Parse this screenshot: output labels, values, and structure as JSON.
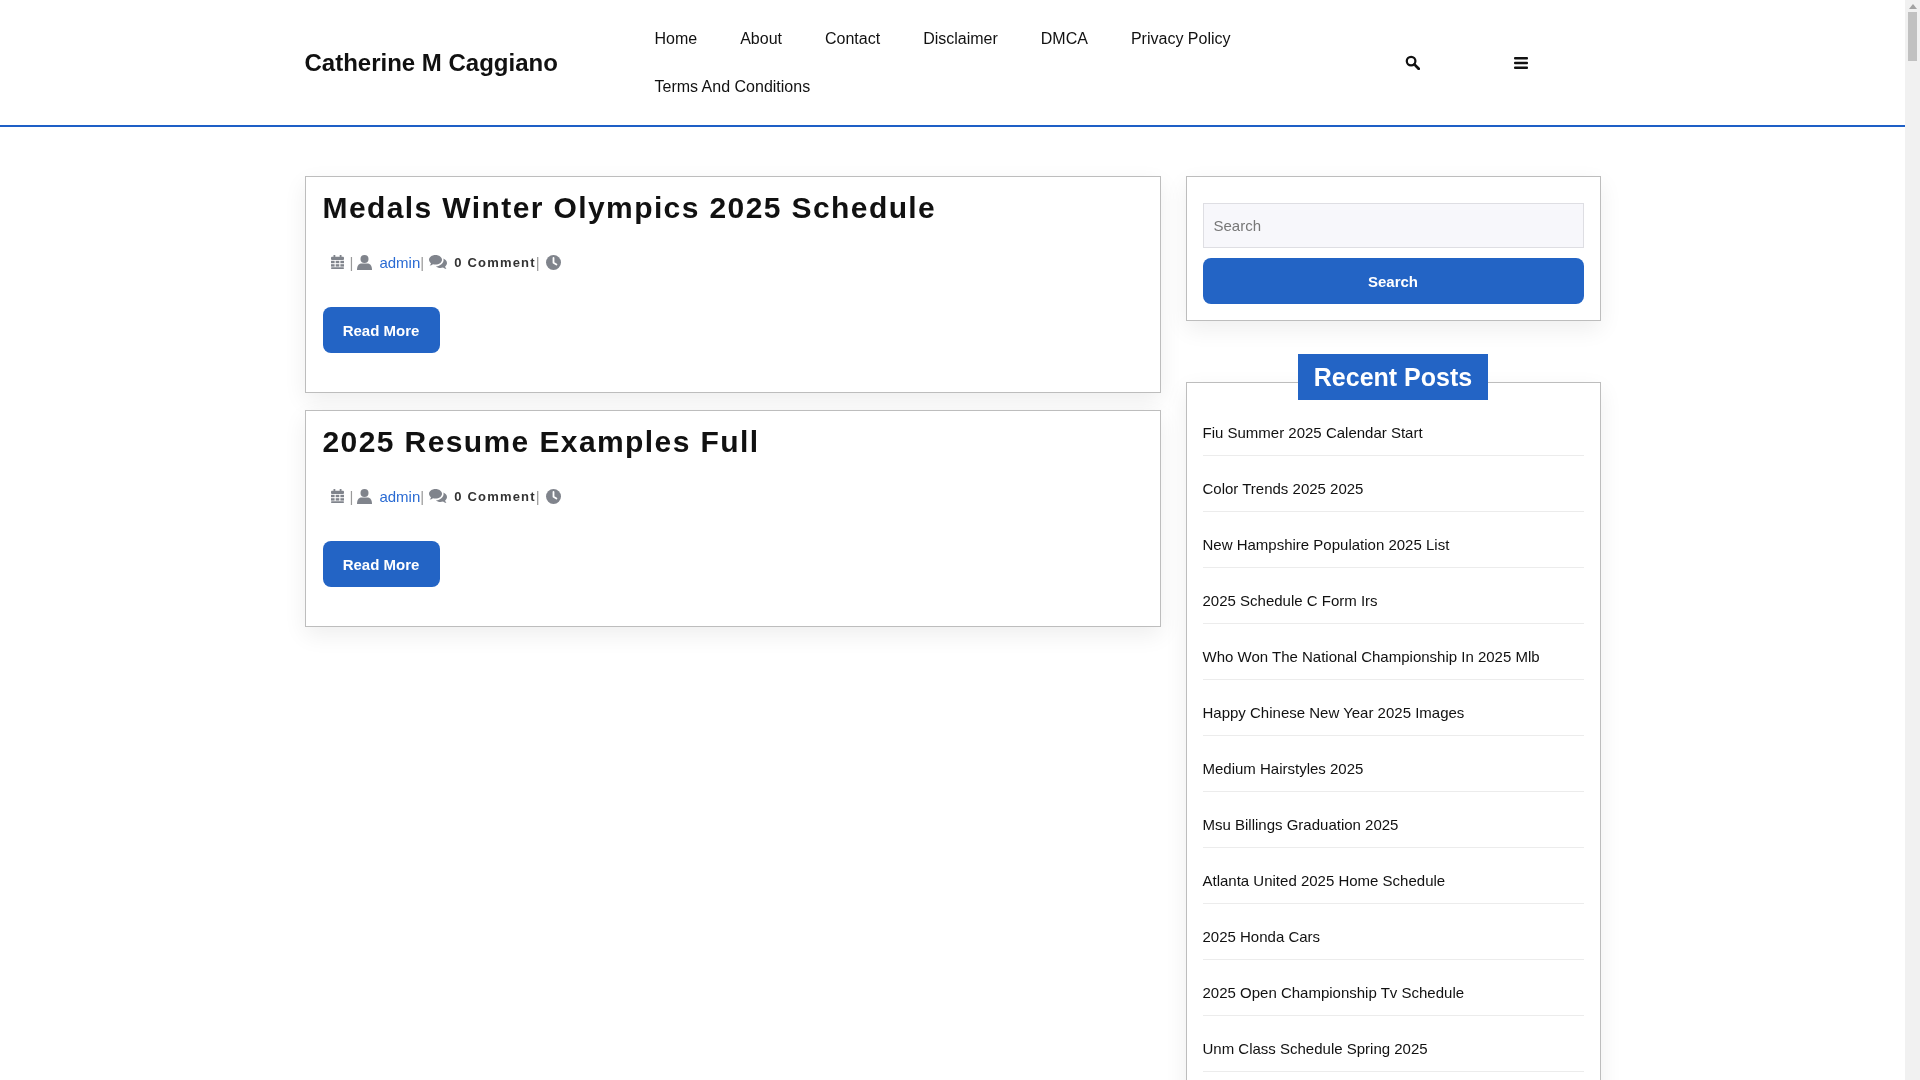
{
  "header": {
    "site_title": "Catherine M Caggiano",
    "nav": [
      "Home",
      "About",
      "Contact",
      "Disclaimer",
      "DMCA",
      "Privacy Policy",
      "Terms And Conditions"
    ]
  },
  "posts": [
    {
      "title": "Medals Winter Olympics 2025 Schedule",
      "meta": {
        "separators": [
          "|",
          "|",
          "|"
        ],
        "author": "admin",
        "comments": "0 Comment"
      },
      "button": "Read More"
    },
    {
      "title": "2025 Resume Examples Full",
      "meta": {
        "separators": [
          "|",
          "|",
          "|"
        ],
        "author": "admin",
        "comments": "0 Comment"
      },
      "button": "Read More"
    }
  ],
  "sidebar": {
    "search": {
      "placeholder": "Search",
      "button": "Search"
    },
    "recent_posts": {
      "title": "Recent Posts",
      "items": [
        "Fiu Summer 2025 Calendar Start",
        "Color Trends 2025 2025",
        "New Hampshire Population 2025 List",
        "2025 Schedule C Form Irs",
        "Who Won The National Championship In 2025 Mlb",
        "Happy Chinese New Year 2025 Images",
        "Medium Hairstyles 2025",
        "Msu Billings Graduation 2025",
        "Atlanta United 2025 Home Schedule",
        "2025 Honda Cars",
        "2025 Open Championship Tv Schedule",
        "Unm Class Schedule Spring 2025"
      ]
    }
  }
}
